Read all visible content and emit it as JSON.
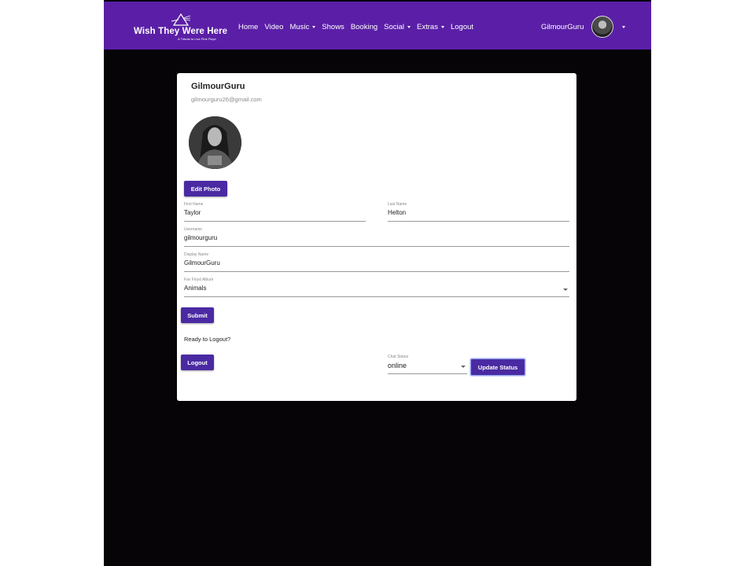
{
  "colors": {
    "navbar_bg": "#5a1fa6",
    "page_bg": "#060406",
    "button_bg": "#4a2aa2",
    "card_bg": "#ffffff"
  },
  "navbar": {
    "brand_title": "Wish They Were Here",
    "brand_subtitle": "A Tribute to Live Pink Floyd",
    "links": [
      {
        "label": "Home",
        "dropdown": false
      },
      {
        "label": "Video",
        "dropdown": false
      },
      {
        "label": "Music",
        "dropdown": true
      },
      {
        "label": "Shows",
        "dropdown": false
      },
      {
        "label": "Booking",
        "dropdown": false
      },
      {
        "label": "Social",
        "dropdown": true
      },
      {
        "label": "Extras",
        "dropdown": true
      },
      {
        "label": "Logout",
        "dropdown": false
      }
    ],
    "user_name": "GilmourGuru"
  },
  "profile": {
    "display_name": "GilmourGuru",
    "email": "gilmourguru26@gmail.com",
    "edit_photo_label": "Edit Photo"
  },
  "form": {
    "first_name": {
      "label": "First Name",
      "value": "Taylor"
    },
    "last_name": {
      "label": "Last Name",
      "value": "Helton"
    },
    "username": {
      "label": "Username",
      "value": "gilmourguru"
    },
    "display_name": {
      "label": "Display Name",
      "value": "GilmourGuru"
    },
    "fav_album": {
      "label": "Fav Floyd Album",
      "value": "Animals"
    },
    "submit_label": "Submit"
  },
  "logout_section": {
    "prompt": "Ready to Logout?",
    "logout_label": "Logout"
  },
  "chat_status": {
    "label": "Chat Status",
    "value": "online",
    "update_label": "Update Status"
  }
}
